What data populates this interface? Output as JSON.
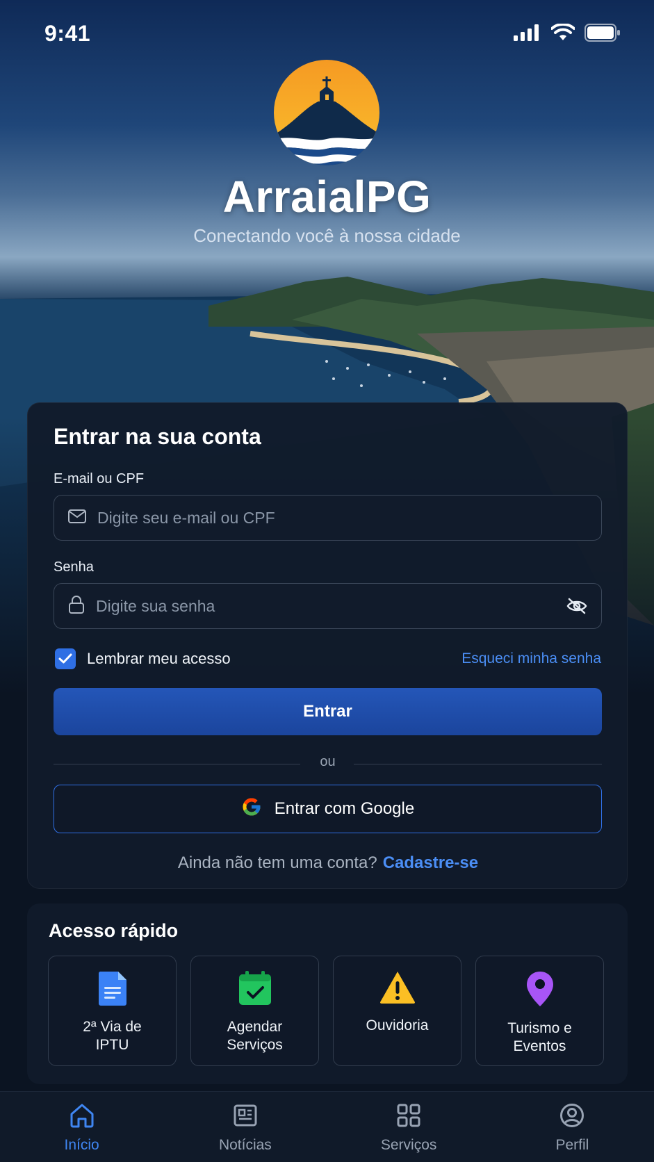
{
  "status_bar": {
    "time": "9:41"
  },
  "header": {
    "app_name": "ArraialPG",
    "tagline": "Conectando você à nossa cidade"
  },
  "login": {
    "title": "Entrar na sua conta",
    "email_label": "E-mail ou CPF",
    "email_placeholder": "Digite seu e-mail ou CPF",
    "password_label": "Senha",
    "password_placeholder": "Digite sua senha",
    "remember_label": "Lembrar meu acesso",
    "remember_checked": true,
    "forgot_label": "Esqueci minha senha",
    "submit_label": "Entrar",
    "divider_label": "ou",
    "google_label": "Entrar com Google",
    "signup_prompt": "Ainda não tem uma conta?",
    "signup_link": "Cadastre-se"
  },
  "quick_access": {
    "title": "Acesso rápido",
    "items": [
      {
        "label": "2ª Via de\nIPTU",
        "icon": "document-icon",
        "color": "#3b82f6"
      },
      {
        "label": "Agendar\nServiços",
        "icon": "calendar-check-icon",
        "color": "#22c55e"
      },
      {
        "label": "Ouvidoria",
        "icon": "warning-icon",
        "color": "#fbbf24"
      },
      {
        "label": "Turismo e\nEventos",
        "icon": "map-pin-icon",
        "color": "#a855f7"
      }
    ]
  },
  "tab_bar": {
    "items": [
      {
        "label": "Início",
        "icon": "home-icon",
        "active": true
      },
      {
        "label": "Notícias",
        "icon": "newspaper-icon",
        "active": false
      },
      {
        "label": "Serviços",
        "icon": "grid-icon",
        "active": false
      },
      {
        "label": "Perfil",
        "icon": "user-circle-icon",
        "active": false
      }
    ]
  },
  "colors": {
    "accent": "#2f6fe4",
    "link": "#4b8ef5",
    "card_bg": "#111b2b"
  }
}
